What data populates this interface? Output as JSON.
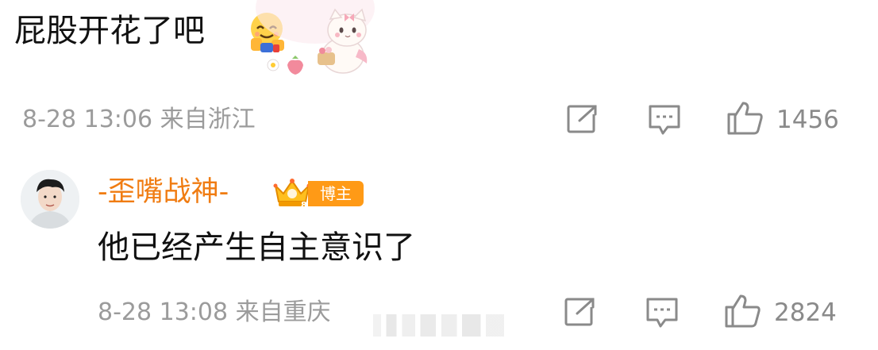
{
  "comments": [
    {
      "text": "屁股开花了吧",
      "emoji": "hug-face-emoji",
      "sticker": "kitten-sticker",
      "meta": "8-28 13:06 来自浙江",
      "likes": "1456"
    },
    {
      "username": "-歪嘴战神-",
      "badge": "博主",
      "text": "他已经产生自主意识了",
      "meta": "8-28 13:08 来自重庆",
      "likes": "2824"
    }
  ],
  "icons": {
    "share": "share-icon",
    "reply": "comment-icon",
    "like": "thumbs-up-icon",
    "crown": "crown-icon"
  },
  "colors": {
    "username": "#f07c12",
    "badge": "#ff9a16",
    "meta": "#9b9b9b"
  }
}
